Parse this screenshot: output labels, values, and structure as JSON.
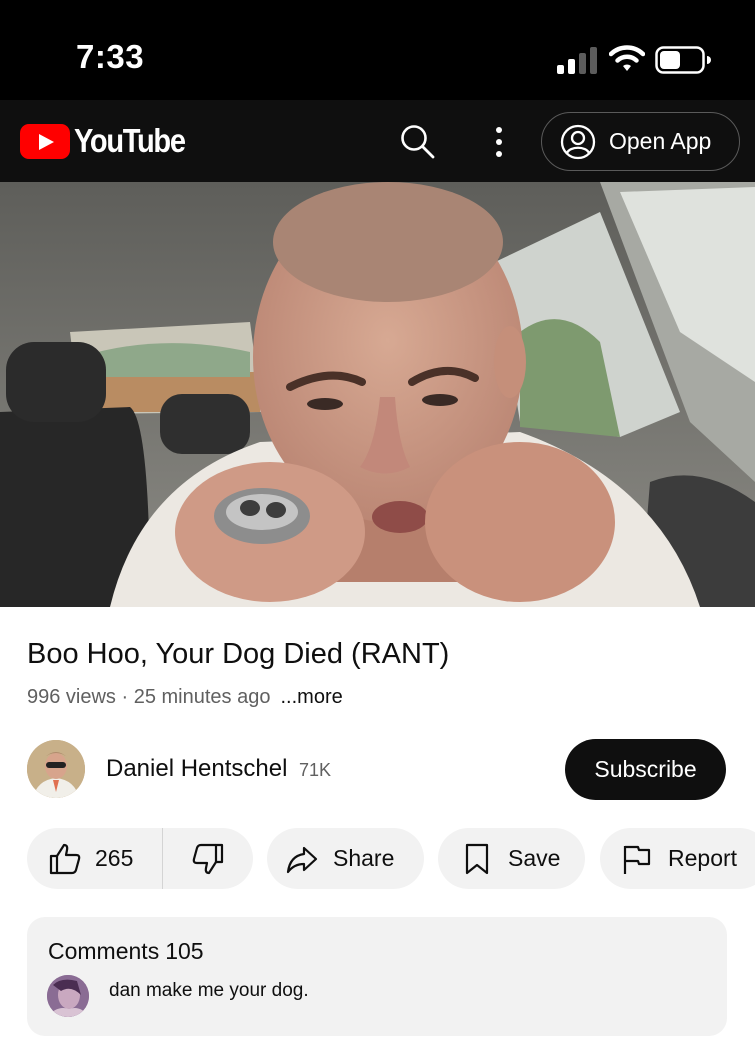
{
  "status_bar": {
    "time": "7:33"
  },
  "header": {
    "logo_text": "YouTube",
    "open_app_label": "Open App",
    "brand_color": "#ff0000"
  },
  "video": {
    "title": "Boo Hoo, Your Dog Died (RANT)",
    "views": "996 views",
    "separator": " · ",
    "age": "25 minutes ago",
    "more_label": "...more"
  },
  "channel": {
    "name": "Daniel Hentschel",
    "subscribers": "71K",
    "subscribe_label": "Subscribe"
  },
  "actions": {
    "like_count": "265",
    "share_label": "Share",
    "save_label": "Save",
    "report_label": "Report"
  },
  "comments": {
    "label": "Comments",
    "count": "105",
    "top_comment": "dan make me your dog."
  }
}
